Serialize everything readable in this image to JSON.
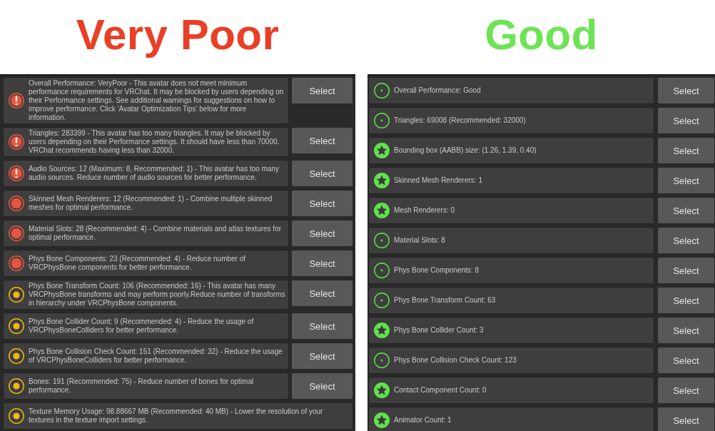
{
  "panels": [
    {
      "title": "Very Poor",
      "color": "#e93f25",
      "items": [
        {
          "kind": "error",
          "text": "Overall Performance: VeryPoor - This avatar does not meet minimum performance requirements for VRChat. It may be blocked by users depending on their Performance settings. See additional warnings for suggestions on how to improve performance. Click 'Avatar Optimization Tips' below for more information.",
          "button": "Select"
        },
        {
          "kind": "error",
          "text": "Triangles: 283399 - This avatar has too many triangles. It may be blocked by users depending on their Performance settings. It should have less than 70000. VRChat recommends having less than 32000.",
          "button": "Select"
        },
        {
          "kind": "error",
          "text": "Audio Sources: 12 (Maximum: 8, Recommended: 1) - This avatar has too many audio sources. Reduce number of audio sources for better performance.",
          "button": "Select"
        },
        {
          "kind": "very_poor",
          "text": "Skinned Mesh Renderers: 12 (Recommended: 1) - Combine multiple skinned meshes for optimal performance.",
          "button": "Select"
        },
        {
          "kind": "very_poor",
          "text": "Material Slots: 28 (Recommended: 4) - Combine materials and atlas textures for optimal performance.",
          "button": "Select"
        },
        {
          "kind": "very_poor",
          "text": "Phys Bone Components: 23 (Recommended: 4) - Reduce number of VRCPhysBone components for better performance.",
          "button": "Select"
        },
        {
          "kind": "poor",
          "text": "Phys Bone Transform Count: 106 (Recommended: 16) - This avatar has many VRCPhysBone transforms and may perform poorly.Reduce number of transforms in hierarchy under VRCPhysBone components.",
          "button": "Select"
        },
        {
          "kind": "poor",
          "text": "Phys Bone Collider Count: 9 (Recommended: 4) - Reduce the usage of VRCPhysBoneColliders for better performance.",
          "button": "Select"
        },
        {
          "kind": "poor",
          "text": "Phys Bone Collision Check Count: 151 (Recommended: 32) - Reduce the usage of VRCPhysBoneColliders for better performance.",
          "button": "Select"
        },
        {
          "kind": "poor",
          "text": "Bones: 191 (Recommended: 75) - Reduce number of bones for optimal performance.",
          "button": "Select"
        },
        {
          "kind": "poor",
          "text": "Texture Memory Usage: 98.88667 MB (Recommended: 40 MB) - Lower the resolution of your textures in the texture import settings."
        }
      ]
    },
    {
      "title": "Good",
      "color": "#6ee356",
      "items": [
        {
          "kind": "good",
          "text": "Overall Performance: Good",
          "button": "Select"
        },
        {
          "kind": "good",
          "text": "Triangles: 69008 (Recommended: 32000)",
          "button": "Select"
        },
        {
          "kind": "excellent",
          "text": "Bounding box (AABB) size: (1.26, 1.39, 0.40)",
          "button": "Select"
        },
        {
          "kind": "excellent",
          "text": "Skinned Mesh Renderers: 1",
          "button": "Select"
        },
        {
          "kind": "excellent",
          "text": "Mesh Renderers: 0",
          "button": "Select"
        },
        {
          "kind": "good",
          "text": "Material Slots: 8",
          "button": "Select"
        },
        {
          "kind": "good",
          "text": "Phys Bone Components: 8",
          "button": "Select"
        },
        {
          "kind": "good",
          "text": "Phys Bone Transform Count: 63",
          "button": "Select"
        },
        {
          "kind": "excellent",
          "text": "Phys Bone Collider Count: 3",
          "button": "Select"
        },
        {
          "kind": "good",
          "text": "Phys Bone Collision Check Count: 123",
          "button": "Select"
        },
        {
          "kind": "excellent",
          "text": "Contact Component Count: 0",
          "button": "Select"
        },
        {
          "kind": "excellent",
          "text": "Animator Count: 1",
          "button": "Select"
        }
      ]
    }
  ]
}
